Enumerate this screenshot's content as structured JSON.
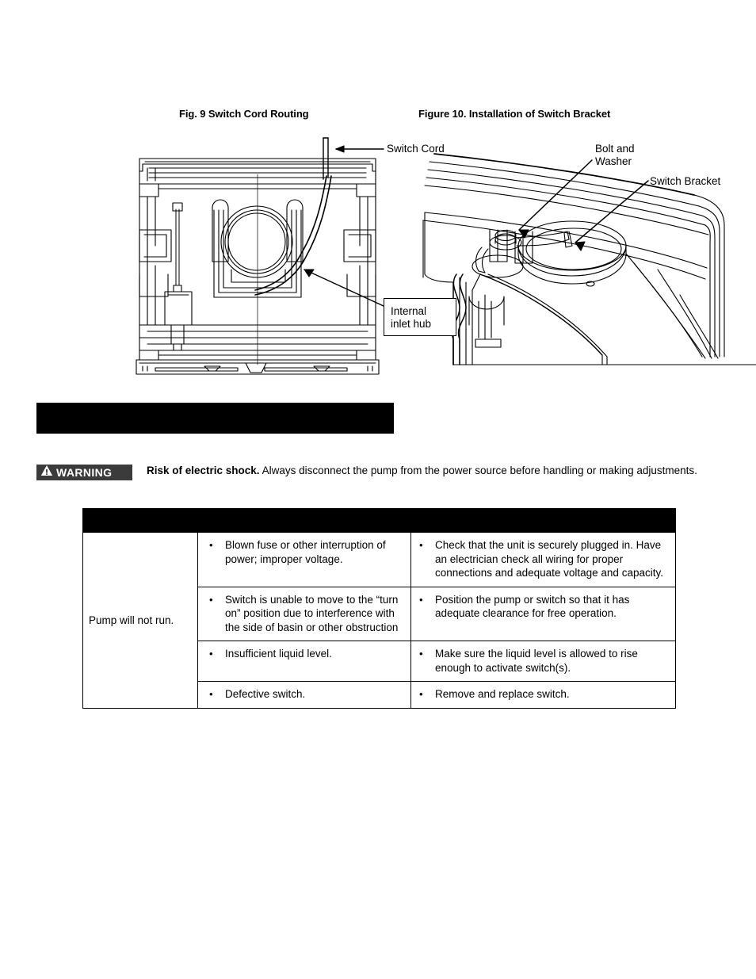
{
  "figures": {
    "fig9": {
      "caption": "Fig. 9 Switch Cord Routing",
      "labels": {
        "switch_cord": "Switch Cord",
        "internal_inlet_hub": "Internal\ninlet hub"
      }
    },
    "fig10": {
      "caption": "Figure 10. Installation of Switch Bracket",
      "labels": {
        "bolt_and_washer": "Bolt and\nWasher",
        "switch_bracket": "Switch Bracket"
      }
    }
  },
  "section_bar": {
    "text": ""
  },
  "warning": {
    "badge_label": "WARNING",
    "bold_lead": "Risk of electric shock.",
    "body": "Always disconnect the pump from the power source before handling or making adjustments."
  },
  "troubleshooting": {
    "header": "",
    "columns": [
      "",
      "",
      ""
    ],
    "rows": [
      {
        "symptom": "Pump will not run.",
        "symptom_rowspan": 4,
        "cause": "Blown fuse or other interruption of power; improper voltage.",
        "remedy": "Check that the unit is securely plugged in. Have an electrician check all wiring for proper connections and adequate voltage and capacity."
      },
      {
        "symptom": "",
        "cause": "Switch is unable to move to the “turn on” position due to interference with the side of basin or other obstruction",
        "remedy": "Position the pump or switch so that it has adequate clearance for free operation."
      },
      {
        "symptom": "",
        "cause": "Insufficient liquid level.",
        "remedy": "Make sure the liquid level is allowed to rise enough to activate switch(s)."
      },
      {
        "symptom": "",
        "cause": "Defective switch.",
        "remedy": "Remove and replace switch."
      }
    ],
    "bullet_glyph": "•"
  },
  "colors": {
    "page_background": "#ffffff",
    "ink": "#000000",
    "warning_badge_background": "#3b3b3b",
    "warning_badge_text": "#ffffff",
    "bar_background": "#000000"
  }
}
